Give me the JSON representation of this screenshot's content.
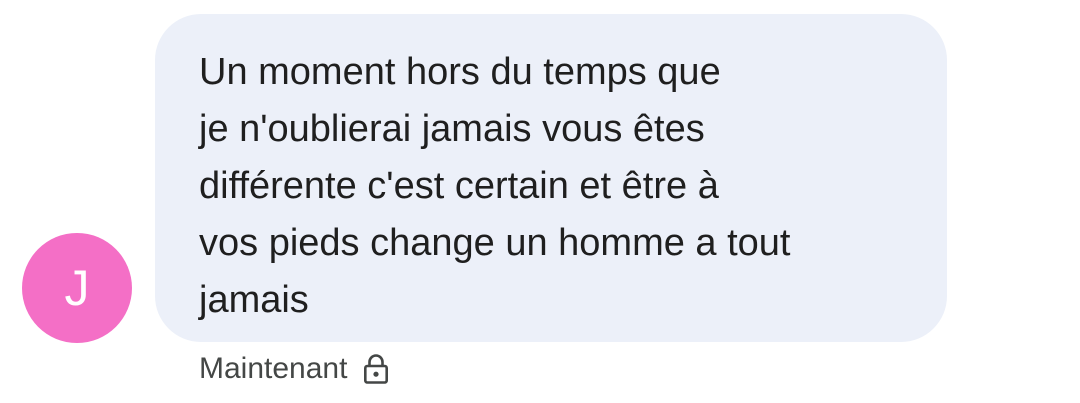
{
  "conversation": {
    "message": {
      "sender_initial": "J",
      "text": "Un moment hors du temps que\nje n'oublierai jamais vous êtes\ndifférente c'est certain et être à\nvos pieds change un homme a tout\njamais",
      "timestamp": "Maintenant",
      "status_icon": "lock-icon"
    }
  },
  "colors": {
    "avatar_bg": "#f46fc6",
    "bubble_bg": "#ecf0f9",
    "text": "#1f1f1f",
    "meta_text": "#444746"
  }
}
